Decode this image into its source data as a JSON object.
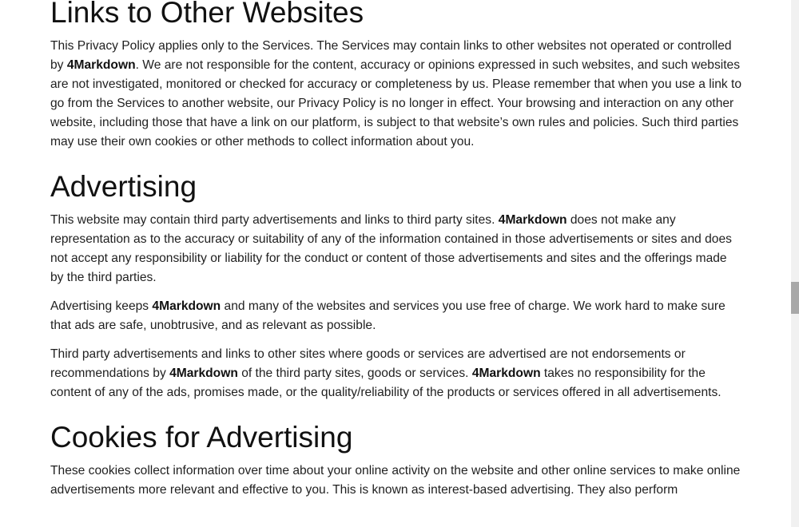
{
  "sections": [
    {
      "heading": "Links to Other Websites",
      "paragraphs": [
        {
          "parts": [
            {
              "t": "This Privacy Policy applies only to the Services. The Services may contain links to other websites not operated or controlled by "
            },
            {
              "t": "4Markdown",
              "b": true
            },
            {
              "t": ". We are not responsible for the content, accuracy or opinions expressed in such websites, and such websites are not investigated, monitored or checked for accuracy or completeness by us. Please remember that when you use a link to go from the Services to another website, our Privacy Policy is no longer in effect. Your browsing and interaction on any other website, including those that have a link on our platform, is subject to that website’s own rules and policies. Such third parties may use their own cookies or other methods to collect information about you."
            }
          ]
        }
      ]
    },
    {
      "heading": "Advertising",
      "paragraphs": [
        {
          "parts": [
            {
              "t": "This website may contain third party advertisements and links to third party sites. "
            },
            {
              "t": "4Markdown",
              "b": true
            },
            {
              "t": " does not make any representation as to the accuracy or suitability of any of the information contained in those advertisements or sites and does not accept any responsibility or liability for the conduct or content of those advertisements and sites and the offerings made by the third parties."
            }
          ]
        },
        {
          "parts": [
            {
              "t": "Advertising keeps "
            },
            {
              "t": "4Markdown",
              "b": true
            },
            {
              "t": " and many of the websites and services you use free of charge. We work hard to make sure that ads are safe, unobtrusive, and as relevant as possible."
            }
          ]
        },
        {
          "parts": [
            {
              "t": "Third party advertisements and links to other sites where goods or services are advertised are not endorsements or recommendations by "
            },
            {
              "t": "4Markdown",
              "b": true
            },
            {
              "t": " of the third party sites, goods or services. "
            },
            {
              "t": "4Markdown",
              "b": true
            },
            {
              "t": " takes no responsibility for the content of any of the ads, promises made, or the quality/reliability of the products or services offered in all advertisements."
            }
          ]
        }
      ]
    },
    {
      "heading": "Cookies for Advertising",
      "paragraphs": [
        {
          "parts": [
            {
              "t": "These cookies collect information over time about your online activity on the website and other online services to make online advertisements more relevant and effective to you. This is known as interest-based advertising. They also perform"
            }
          ]
        }
      ]
    }
  ]
}
